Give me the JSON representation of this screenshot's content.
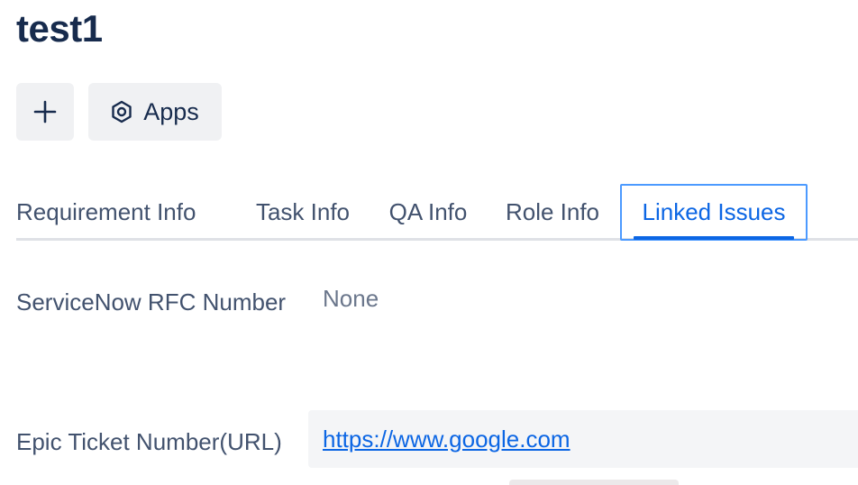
{
  "issue": {
    "title": "test1"
  },
  "toolbar": {
    "add_icon": "plus-icon",
    "apps_icon": "hexagon-gear-icon",
    "apps_label": "Apps"
  },
  "tabs": [
    {
      "label": "Requirement Info",
      "active": false
    },
    {
      "label": "Task Info",
      "active": false
    },
    {
      "label": "QA Info",
      "active": false
    },
    {
      "label": "Role Info",
      "active": false
    },
    {
      "label": "Linked Issues",
      "active": true
    }
  ],
  "fields": [
    {
      "label": "ServiceNow RFC Number",
      "value": "None"
    },
    {
      "label": "Epic Ticket Number(URL)",
      "value": "https://www.google.com"
    }
  ],
  "colors": {
    "text_primary": "#172b4d",
    "text_secondary": "#42526e",
    "accent": "#0c66e4",
    "focus_ring": "#4c9aff"
  }
}
